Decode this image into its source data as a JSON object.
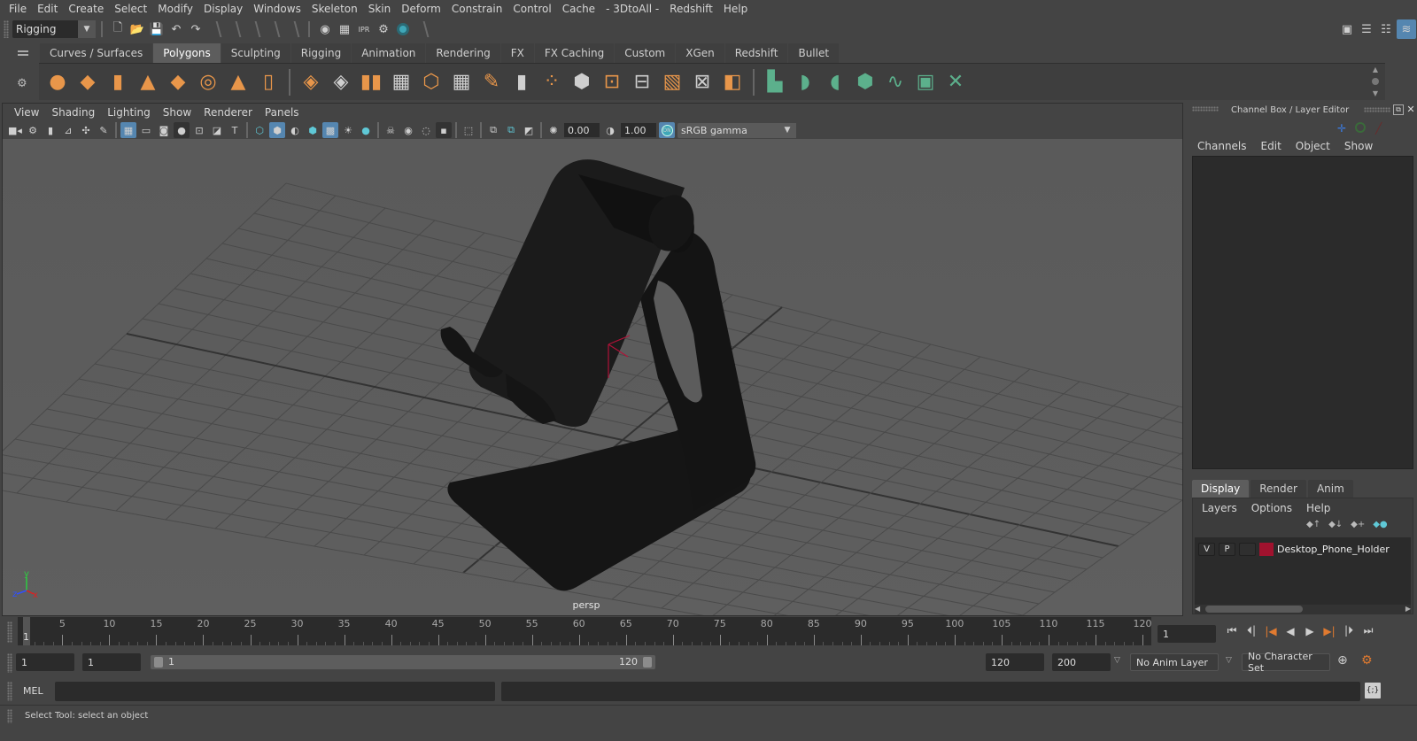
{
  "menubar": {
    "items": [
      "File",
      "Edit",
      "Create",
      "Select",
      "Modify",
      "Display",
      "Windows",
      "Skeleton",
      "Skin",
      "Deform",
      "Constrain",
      "Control",
      "Cache",
      "- 3DtoAll -",
      "Redshift",
      "Help"
    ]
  },
  "statusline": {
    "menuset": "Rigging",
    "icons": [
      "new-scene-icon",
      "open-scene-icon",
      "save-scene-icon",
      "undo-icon",
      "redo-icon"
    ],
    "render_icons": [
      "render-view-icon",
      "render-frame-icon",
      "ipr-render-icon",
      "render-settings-icon",
      "hypershade-icon"
    ],
    "right_icons": [
      "modeling-toolkit-icon",
      "attribute-editor-icon",
      "tool-settings-icon",
      "channel-box-icon"
    ]
  },
  "shelf": {
    "tabs": [
      "Curves / Surfaces",
      "Polygons",
      "Sculpting",
      "Rigging",
      "Animation",
      "Rendering",
      "FX",
      "FX Caching",
      "Custom",
      "XGen",
      "Redshift",
      "Bullet"
    ],
    "active_tab": "Polygons",
    "poly_icons": [
      "sphere",
      "cube",
      "cylinder",
      "cone",
      "plane",
      "torus",
      "pyramid",
      "pipe"
    ],
    "tool_icons": [
      "combine",
      "separate",
      "mirror",
      "smooth",
      "bevel",
      "subdivide",
      "multicut",
      "extrude",
      "bridge",
      "merge",
      "boolean",
      "insert-edge-loop",
      "offset-edge-loop",
      "target-weld",
      "append-polygon"
    ],
    "uv_icons": [
      "planar-uv",
      "cylindrical-uv",
      "spherical-uv",
      "automatic-uv",
      "unfold-uv",
      "uv-editor",
      "layout-uv"
    ]
  },
  "viewport": {
    "menu": [
      "View",
      "Shading",
      "Lighting",
      "Show",
      "Renderer",
      "Panels"
    ],
    "exposure": "0.00",
    "gamma": "1.00",
    "colorspace_toggle": "ON",
    "colorspace": "sRGB gamma",
    "camera_label": "persp",
    "axis": {
      "y": "y",
      "z": "z",
      "x": "x"
    },
    "object_name": "Desktop_Phone_Holder"
  },
  "panel": {
    "title": "Channel Box / Layer Editor",
    "channel_menu": [
      "Channels",
      "Edit",
      "Object",
      "Show"
    ],
    "layer_tabs": [
      "Display",
      "Render",
      "Anim"
    ],
    "active_layer_tab": "Display",
    "layer_menu": [
      "Layers",
      "Options",
      "Help"
    ],
    "layers": [
      {
        "v": "V",
        "p": "P",
        "color": "#a0122e",
        "name": "Desktop_Phone_Holder"
      }
    ]
  },
  "timeline": {
    "current_frame_marker": "1",
    "labels": [
      "5",
      "10",
      "15",
      "20",
      "25",
      "30",
      "35",
      "40",
      "45",
      "50",
      "55",
      "60",
      "65",
      "70",
      "75",
      "80",
      "85",
      "90",
      "95",
      "100",
      "105",
      "110",
      "115",
      "120"
    ],
    "current_frame": "1"
  },
  "range": {
    "start": "1",
    "playback_start": "1",
    "slider_start": "1",
    "slider_end": "120",
    "playback_end": "120",
    "end": "200",
    "anim_layer": "No Anim Layer",
    "character_set": "No Character Set"
  },
  "command": {
    "mode": "MEL",
    "input": "",
    "result": ""
  },
  "help_line": "Select Tool: select an object"
}
